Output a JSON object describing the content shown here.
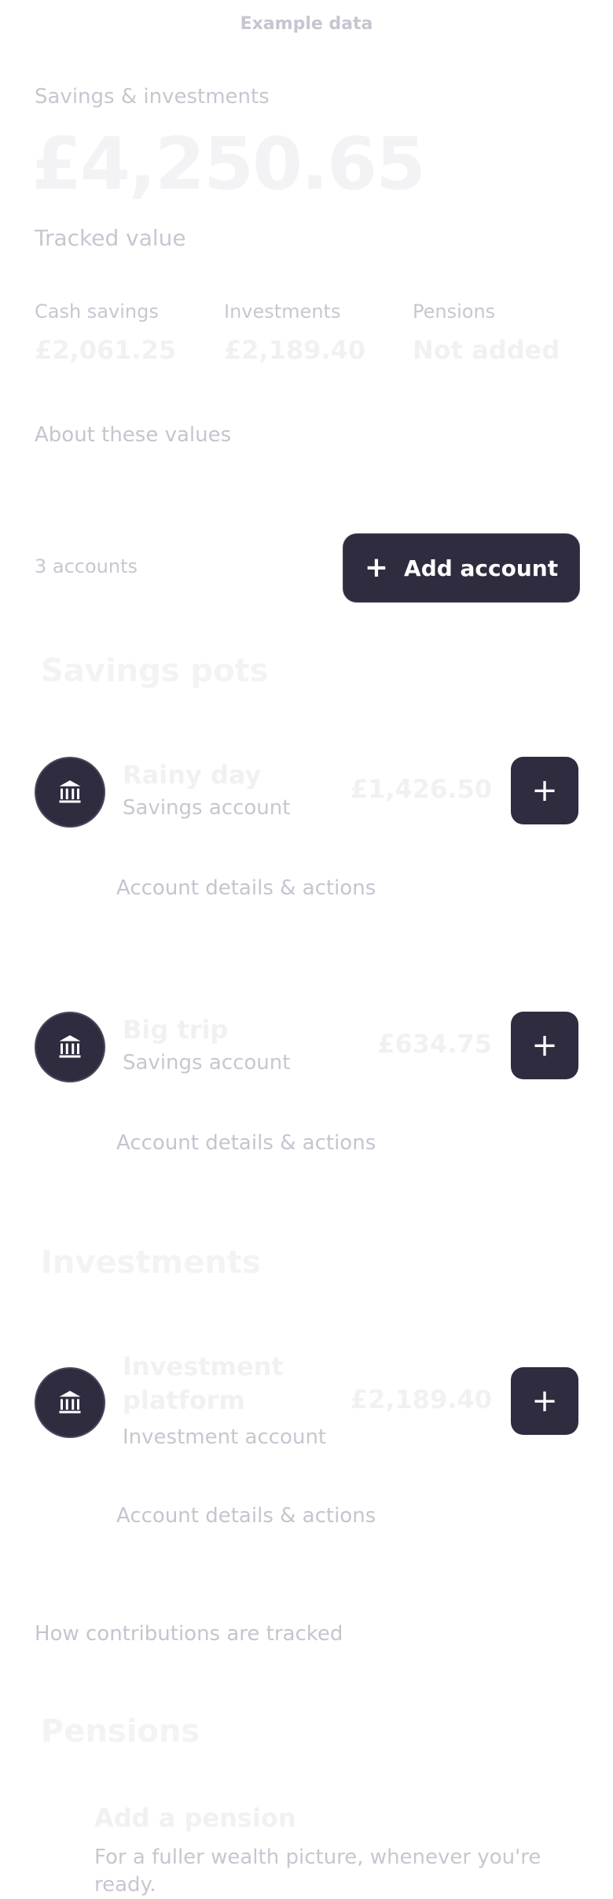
{
  "top_label": "Example data",
  "summary": {
    "label": "Savings & investments",
    "value": "£4,250.65",
    "sub": "Tracked value",
    "stats": [
      {
        "title": "Cash savings",
        "value": "£2,061.25"
      },
      {
        "title": "Investments",
        "value": "£2,189.40"
      },
      {
        "title": "Pensions",
        "value": "Not added"
      }
    ],
    "about_link": "About these values"
  },
  "toolbar": {
    "accounts_count": "3 accounts",
    "add_account_label": "Add account"
  },
  "sections": {
    "savings": {
      "title": "Savings pots",
      "accounts": [
        {
          "name": "Rainy day",
          "type": "Savings account",
          "amount": "£1,426.50",
          "details": "Account details & actions"
        },
        {
          "name": "Big trip",
          "type": "Savings account",
          "amount": "£634.75",
          "details": "Account details & actions"
        }
      ]
    },
    "investments": {
      "title": "Investments",
      "accounts": [
        {
          "name_line1": "Investment",
          "name_line2": "platform",
          "type": "Investment account",
          "amount": "£2,189.40",
          "details": "Account details & actions"
        }
      ],
      "contributions_link": "How contributions are tracked"
    },
    "pensions": {
      "title": "Pensions",
      "add_title": "Add a pension",
      "body_line1": "For a fuller wealth picture, whenever you're",
      "body_line2": "ready."
    }
  }
}
